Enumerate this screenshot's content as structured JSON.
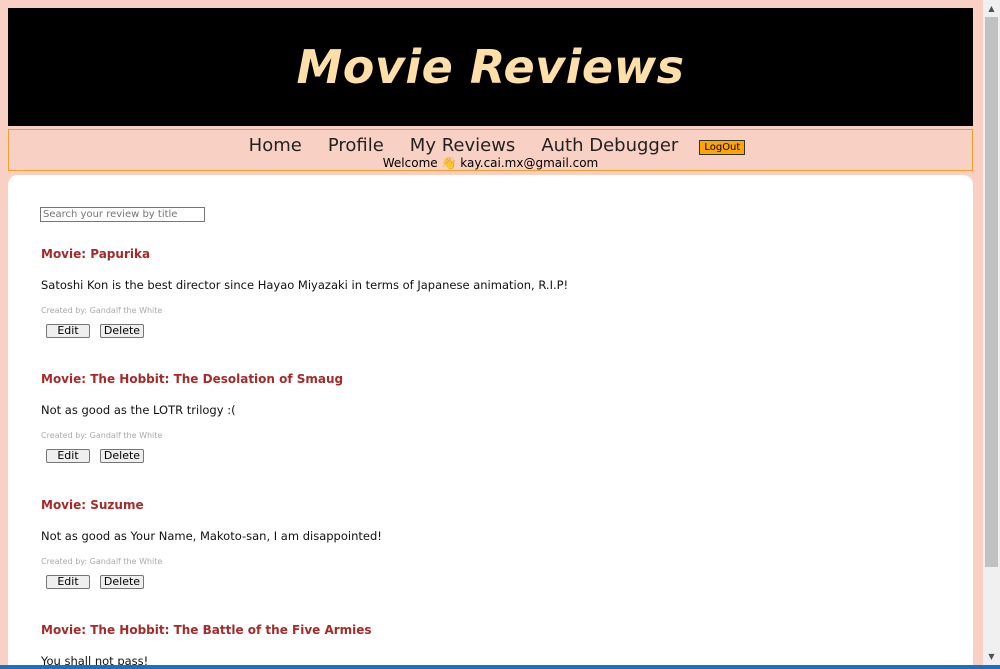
{
  "header": {
    "title": "Movie Reviews"
  },
  "nav": {
    "items": [
      {
        "label": "Home"
      },
      {
        "label": "Profile"
      },
      {
        "label": "My Reviews"
      },
      {
        "label": "Auth Debugger"
      }
    ],
    "logout_label": "LogOut",
    "welcome_prefix": "Welcome",
    "wave_icon": "👋",
    "user_email": "kay.cai.mx@gmail.com"
  },
  "search": {
    "placeholder": "Search your review by title",
    "value": ""
  },
  "reviews": [
    {
      "title": "Movie: Papurika",
      "body": "Satoshi Kon is the best director since Hayao Miyazaki in terms of Japanese animation, R.I.P!",
      "meta": "Created by: Gandalf the White",
      "edit_label": "Edit",
      "delete_label": "Delete"
    },
    {
      "title": "Movie: The Hobbit: The Desolation of Smaug",
      "body": "Not as good as the LOTR trilogy :(",
      "meta": "Created by: Gandalf the White",
      "edit_label": "Edit",
      "delete_label": "Delete"
    },
    {
      "title": "Movie: Suzume",
      "body": "Not as good as Your Name, Makoto-san, I am disappointed!",
      "meta": "Created by: Gandalf the White",
      "edit_label": "Edit",
      "delete_label": "Delete"
    },
    {
      "title": "Movie: The Hobbit: The Battle of the Five Armies",
      "body": "You shall not pass!",
      "meta": "",
      "edit_label": "",
      "delete_label": ""
    }
  ],
  "scrollbar": {
    "up_icon": "▲",
    "down_icon": "▼"
  },
  "colors": {
    "page_background": "#f9d0c4",
    "header_background": "#000000",
    "title_color": "#ffdfa8",
    "review_title_color": "#a52a2a",
    "logout_background": "#ffa500"
  }
}
